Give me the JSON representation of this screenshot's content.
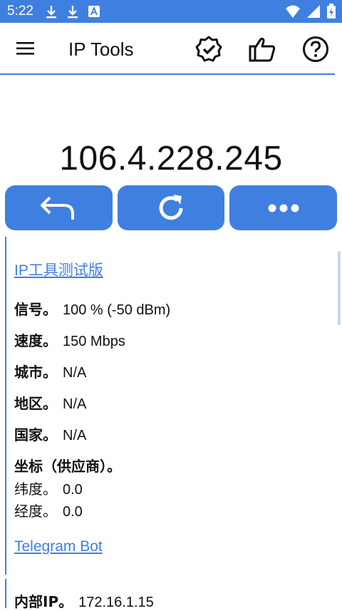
{
  "status_bar": {
    "time": "5:22",
    "left_icons": [
      "download-icon",
      "download-icon",
      "app-a-icon"
    ],
    "right_icons": [
      "wifi-icon",
      "signal-icon",
      "battery-icon"
    ]
  },
  "app_bar": {
    "title": "IP Tools",
    "actions": [
      "verified-badge-icon",
      "thumbs-up-icon",
      "help-icon"
    ]
  },
  "ip_address": "106.4.228.245",
  "action_buttons": [
    "back-arrow-icon",
    "refresh-icon",
    "more-icon"
  ],
  "info": {
    "link_title": "IP工具测试版",
    "signal_label": "信号。",
    "signal_value": "100 % (-50 dBm)",
    "speed_label": "速度。",
    "speed_value": "150 Mbps",
    "city_label": "城市。",
    "city_value": "N/A",
    "region_label": "地区。",
    "region_value": "N/A",
    "country_label": "国家。",
    "country_value": "N/A",
    "coords_label": "坐标（供应商）。",
    "lat_label": "纬度。",
    "lat_value": "0.0",
    "lon_label": "经度。",
    "lon_value": "0.0",
    "telegram_link": "Telegram Bot"
  },
  "internal": {
    "label": "内部IP。",
    "value": "172.16.1.15"
  },
  "colors": {
    "accent": "#3f7fe0",
    "text": "#111111",
    "background": "#ffffff"
  }
}
